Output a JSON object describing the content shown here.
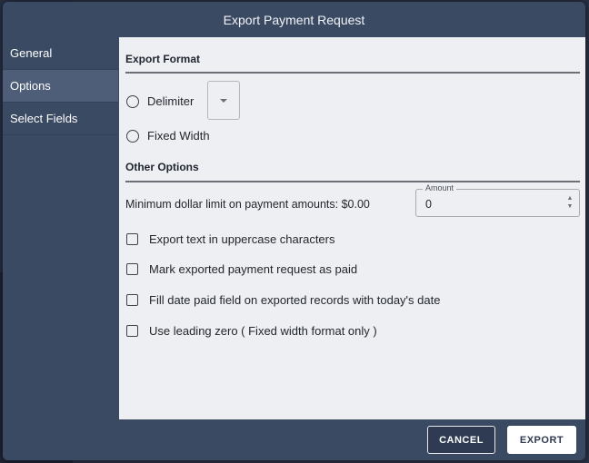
{
  "dialog": {
    "title": "Export Payment Request"
  },
  "sidebar": {
    "items": [
      {
        "label": "General"
      },
      {
        "label": "Options"
      },
      {
        "label": "Select Fields"
      }
    ],
    "active": "Options"
  },
  "export_format": {
    "title": "Export Format",
    "options": [
      {
        "label": "Delimiter",
        "selected": false
      },
      {
        "label": "Fixed Width",
        "selected": false
      }
    ],
    "delimiter_value": ""
  },
  "other_options": {
    "title": "Other Options",
    "min_dollar_label": "Minimum dollar limit on payment amounts: $0.00",
    "amount": {
      "legend": "Amount",
      "value": "0"
    },
    "checkboxes": [
      {
        "label": "Export text in uppercase characters",
        "checked": false
      },
      {
        "label": "Mark exported payment request as paid",
        "checked": false
      },
      {
        "label": "Fill date paid field on exported records with today's date",
        "checked": false
      },
      {
        "label": "Use leading zero ( Fixed width format only )",
        "checked": false
      }
    ]
  },
  "footer": {
    "cancel_label": "CANCEL",
    "export_label": "EXPORT"
  },
  "colors": {
    "dialog_bg": "#3b4a63",
    "sidebar_active": "#4e5e79",
    "content_bg": "#eeeff2"
  }
}
